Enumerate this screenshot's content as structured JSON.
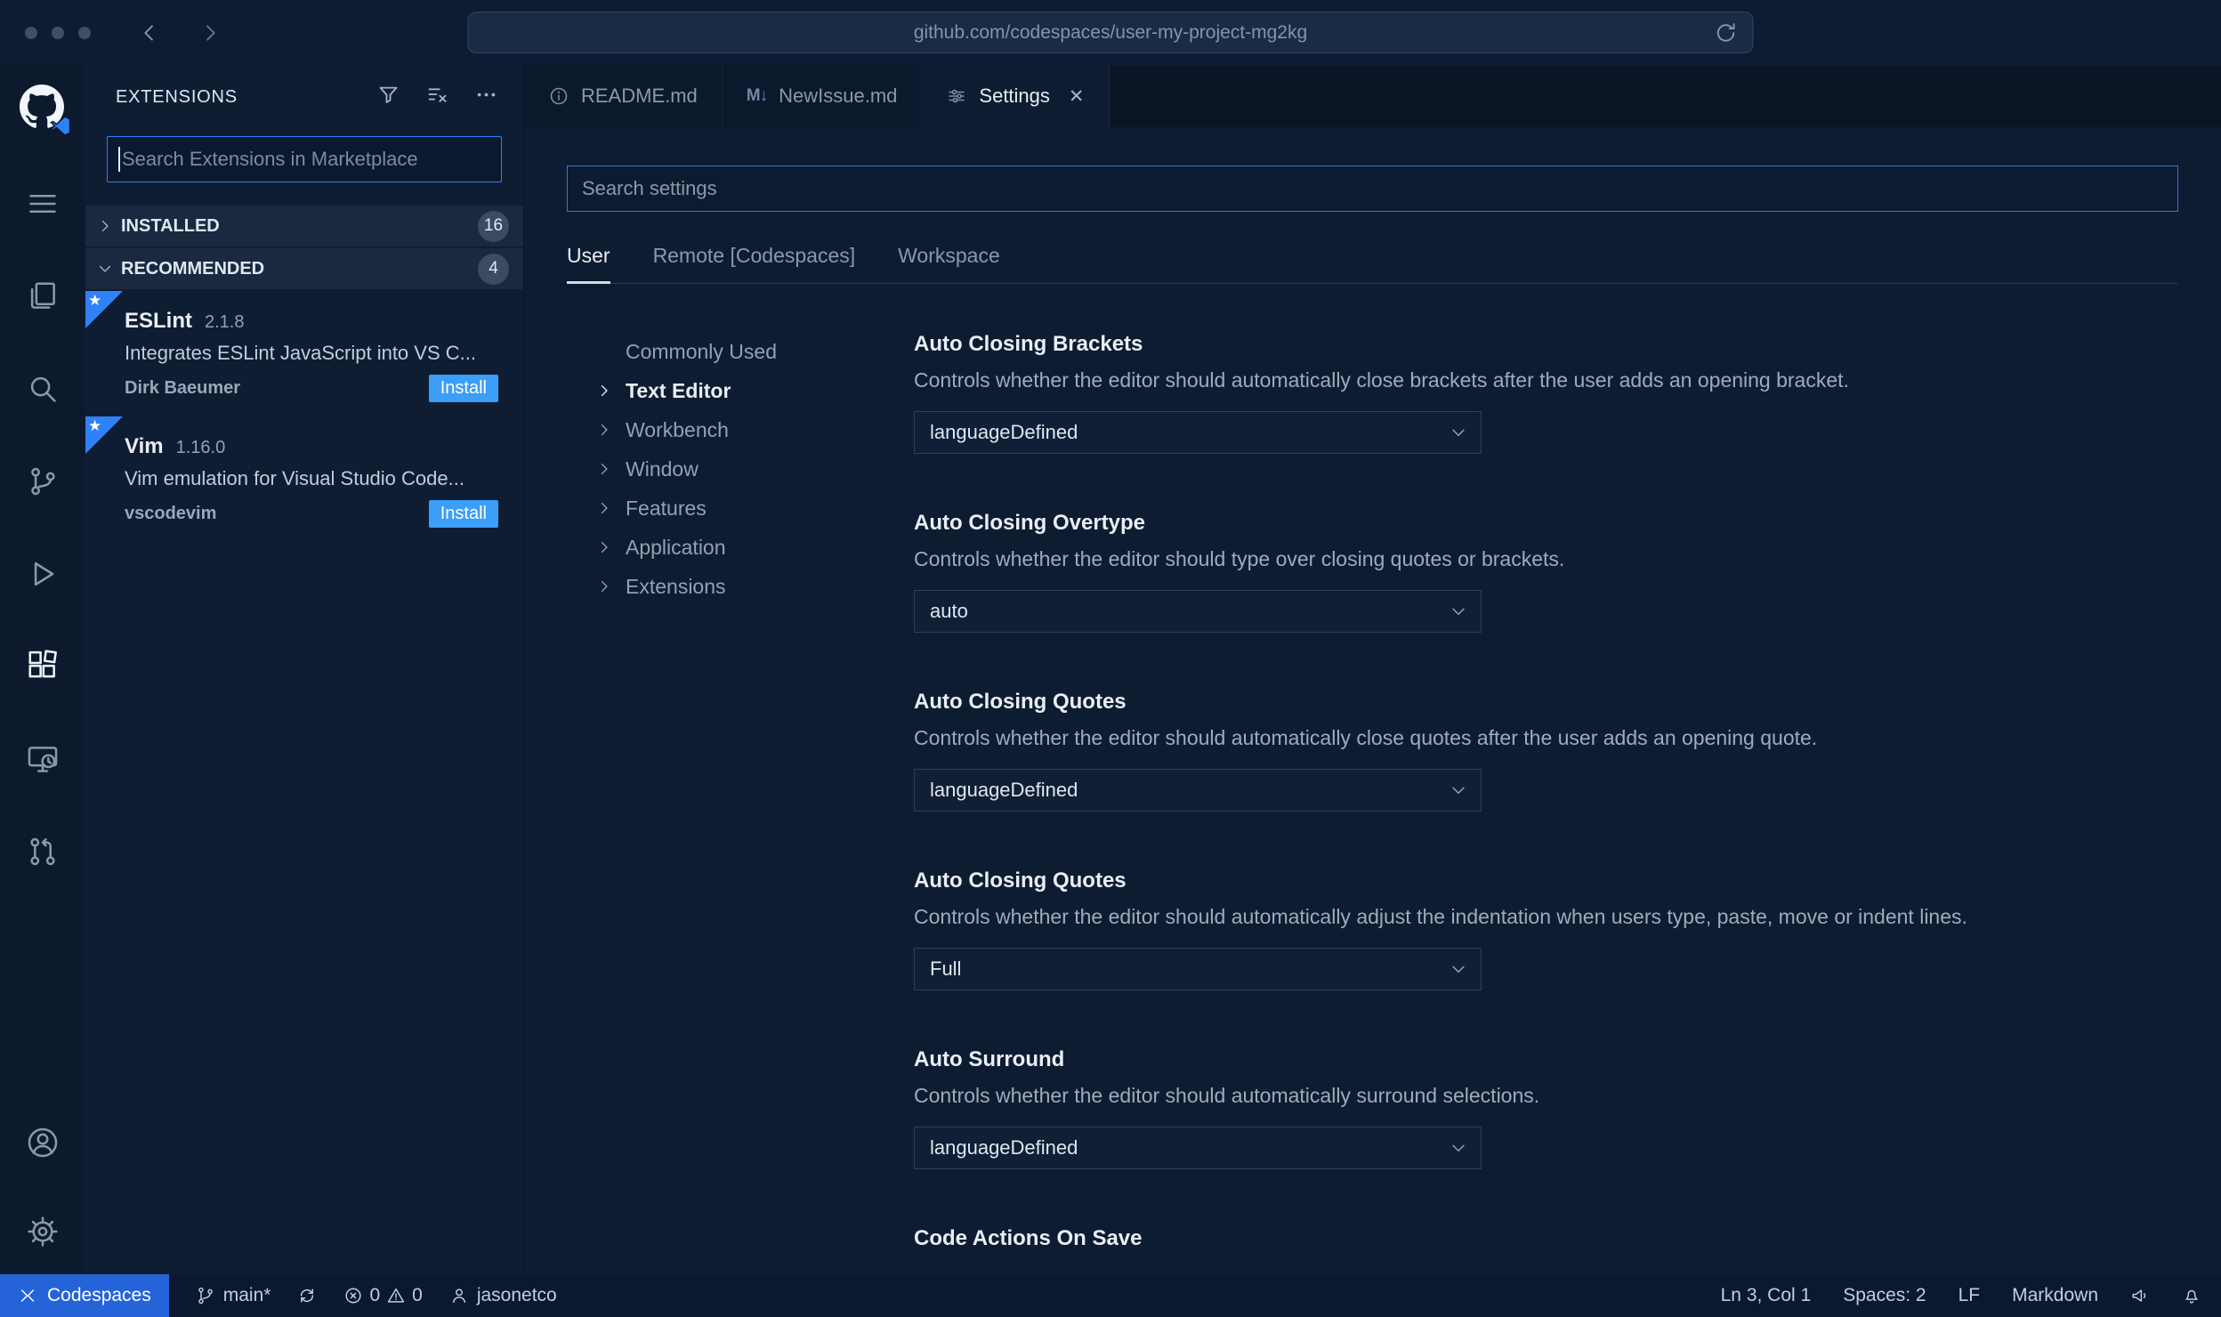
{
  "browser": {
    "url": "github.com/codespaces/user-my-project-mg2kg"
  },
  "activity_bar": {
    "items": [
      "github-logo",
      "menu",
      "explorer",
      "search",
      "source-control",
      "run-debug",
      "extensions",
      "remote-explorer",
      "pull-requests",
      "account",
      "settings-gear"
    ],
    "active": "extensions"
  },
  "sidebar": {
    "title": "EXTENSIONS",
    "search_placeholder": "Search Extensions in Marketplace",
    "sections": [
      {
        "label": "INSTALLED",
        "badge": "16"
      },
      {
        "label": "RECOMMENDED",
        "badge": "4"
      }
    ],
    "extensions": [
      {
        "name": "ESLint",
        "version": "2.1.8",
        "description": "Integrates ESLint JavaScript into VS C...",
        "author": "Dirk Baeumer",
        "action": "Install"
      },
      {
        "name": "Vim",
        "version": "1.16.0",
        "description": "Vim emulation for Visual Studio Code...",
        "author": "vscodevim",
        "action": "Install"
      }
    ]
  },
  "tabs": [
    {
      "label": "README.md"
    },
    {
      "label": "NewIssue.md",
      "icon_text": "M↓"
    },
    {
      "label": "Settings",
      "close": "✕"
    }
  ],
  "settings": {
    "search_placeholder": "Search settings",
    "scope_tabs": [
      "User",
      "Remote [Codespaces]",
      "Workspace"
    ],
    "toc": [
      {
        "label": "Commonly Used"
      },
      {
        "label": "Text Editor"
      },
      {
        "label": "Workbench"
      },
      {
        "label": "Window"
      },
      {
        "label": "Features"
      },
      {
        "label": "Application"
      },
      {
        "label": "Extensions"
      }
    ],
    "items": [
      {
        "title": "Auto Closing Brackets",
        "description": "Controls whether the editor should automatically close brackets after the user adds an opening bracket.",
        "value": "languageDefined"
      },
      {
        "title": "Auto Closing Overtype",
        "description": "Controls whether the editor should type over closing quotes or brackets.",
        "value": "auto"
      },
      {
        "title": "Auto Closing Quotes",
        "description": "Controls whether the editor should automatically close quotes after the user adds an opening quote.",
        "value": "languageDefined"
      },
      {
        "title": "Auto Closing Quotes",
        "description": "Controls whether the editor should automatically adjust the indentation when users type, paste, move or indent lines.",
        "value": "Full"
      },
      {
        "title": "Auto Surround",
        "description": "Controls whether the editor should automatically surround selections.",
        "value": "languageDefined"
      },
      {
        "title": "Code Actions On Save"
      }
    ]
  },
  "status_bar": {
    "codespaces": "Codespaces",
    "branch": "main*",
    "errors": "0",
    "warnings": "0",
    "user": "jasonetco",
    "line_col": "Ln 3, Col 1",
    "spaces": "Spaces: 2",
    "eol": "LF",
    "language": "Markdown"
  }
}
